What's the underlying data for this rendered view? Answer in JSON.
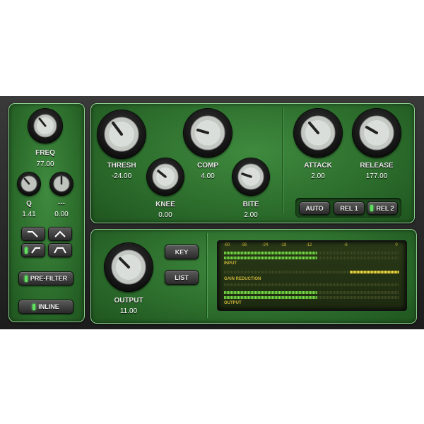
{
  "filter_section": {
    "freq": {
      "label": "FREQ",
      "value": "77.00"
    },
    "q": {
      "label": "Q",
      "value": "1.41"
    },
    "unnamed": {
      "label": "---",
      "value": "0.00"
    },
    "pre_filter": {
      "label": "PRE-FILTER",
      "led_on": true
    },
    "inline": {
      "label": "INLINE",
      "led_on": true
    }
  },
  "compressor_section": {
    "thresh": {
      "label": "THRESH",
      "value": "-24.00"
    },
    "comp": {
      "label": "COMP",
      "value": "4.00"
    },
    "knee": {
      "label": "KNEE",
      "value": "0.00"
    },
    "bite": {
      "label": "BITE",
      "value": "2.00"
    }
  },
  "timing_section": {
    "attack": {
      "label": "ATTACK",
      "value": "2.00"
    },
    "release": {
      "label": "RELEASE",
      "value": "177.00"
    },
    "release_modes": [
      {
        "label": "AUTO",
        "selected": false
      },
      {
        "label": "REL 1",
        "selected": false
      },
      {
        "label": "REL 2",
        "selected": true
      }
    ]
  },
  "output_section": {
    "output": {
      "label": "OUTPUT",
      "value": "11.00"
    },
    "key_label": "KEY",
    "list_label": "LIST"
  },
  "meter": {
    "scale": [
      "-60",
      "-36",
      "-24",
      "-18",
      "-12",
      "-6",
      "0"
    ],
    "input_label": "INPUT",
    "gain_reduction_label": "GAIN REDUCTION",
    "output_label": "OUTPUT",
    "input_levels": [
      0.53,
      0.53
    ],
    "gain_reduction_levels": [
      0.28,
      0.0
    ],
    "output_levels": [
      0.53,
      0.53
    ]
  },
  "colors": {
    "panel_green": "#2d6e2d",
    "led_on": "#5fe05f",
    "meter_yellow": "#f0e050"
  }
}
